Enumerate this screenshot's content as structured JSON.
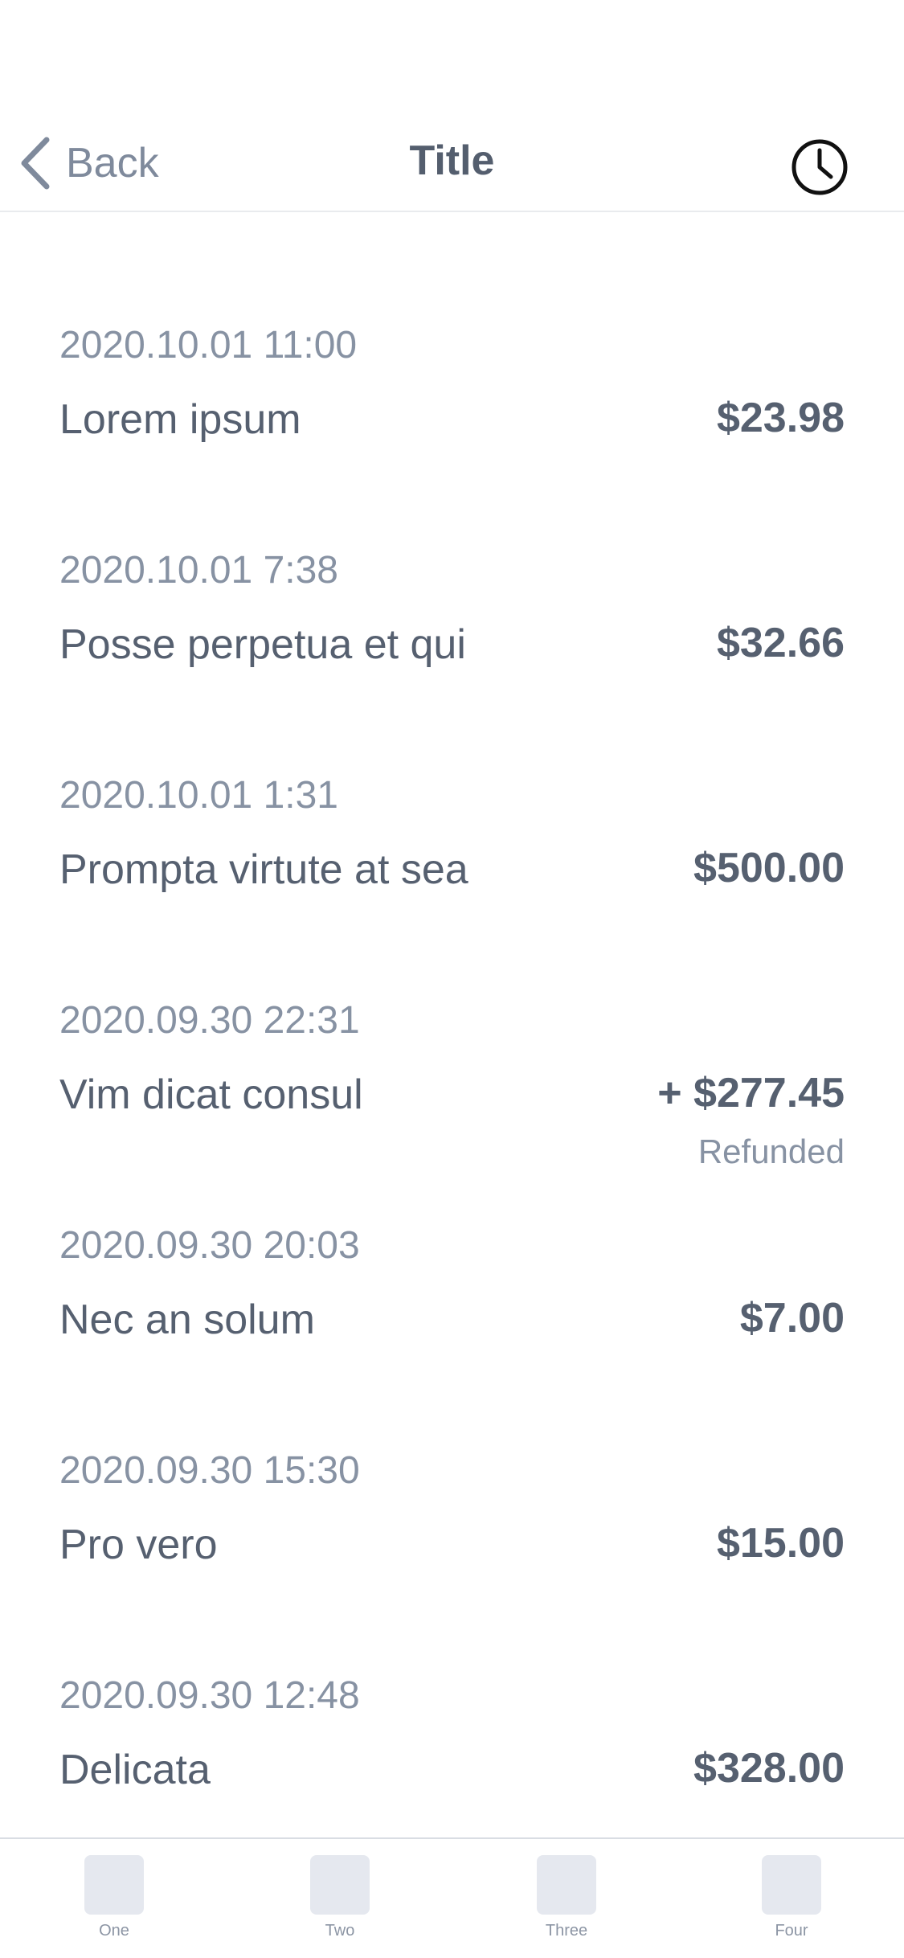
{
  "nav": {
    "back_label": "Back",
    "title": "Title",
    "right_icon": "clock-icon"
  },
  "transactions": [
    {
      "date": "2020.10.01 11:00",
      "title": "Lorem ipsum",
      "amount": "$23.98",
      "status": ""
    },
    {
      "date": "2020.10.01 7:38",
      "title": "Posse perpetua et qui",
      "amount": "$32.66",
      "status": ""
    },
    {
      "date": "2020.10.01 1:31",
      "title": "Prompta virtute at sea",
      "amount": "$500.00",
      "status": ""
    },
    {
      "date": "2020.09.30 22:31",
      "title": "Vim dicat consul",
      "amount": "+ $277.45",
      "status": "Refunded"
    },
    {
      "date": "2020.09.30 20:03",
      "title": "Nec an solum",
      "amount": "$7.00",
      "status": ""
    },
    {
      "date": "2020.09.30 15:30",
      "title": "Pro vero",
      "amount": "$15.00",
      "status": ""
    },
    {
      "date": "2020.09.30 12:48",
      "title": "Delicata",
      "amount": "$328.00",
      "status": ""
    }
  ],
  "tabs": [
    {
      "label": "One"
    },
    {
      "label": "Two"
    },
    {
      "label": "Three"
    },
    {
      "label": "Four"
    }
  ],
  "colors": {
    "text_primary": "#566070",
    "text_secondary": "#8792a3",
    "tab_placeholder": "#e5e8ef",
    "divider": "#e9ebee"
  }
}
